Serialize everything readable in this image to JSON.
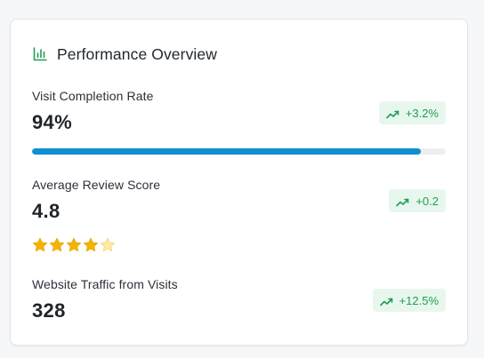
{
  "card": {
    "title": "Performance Overview",
    "icon": "bar-chart-icon",
    "accent_color": "#1e9e53"
  },
  "metrics": [
    {
      "label": "Visit Completion Rate",
      "value": "94%",
      "trend": "+3.2%",
      "trend_icon": "trending-up-icon",
      "progress_fraction": 0.94,
      "progress_color": "#0e8fd1"
    },
    {
      "label": "Average Review Score",
      "value": "4.8",
      "trend": "+0.2",
      "trend_icon": "trending-up-icon",
      "stars_filled": 4,
      "stars_total": 5,
      "star_color": "#f5b400"
    },
    {
      "label": "Website Traffic from Visits",
      "value": "328",
      "trend": "+12.5%",
      "trend_icon": "trending-up-icon"
    }
  ]
}
